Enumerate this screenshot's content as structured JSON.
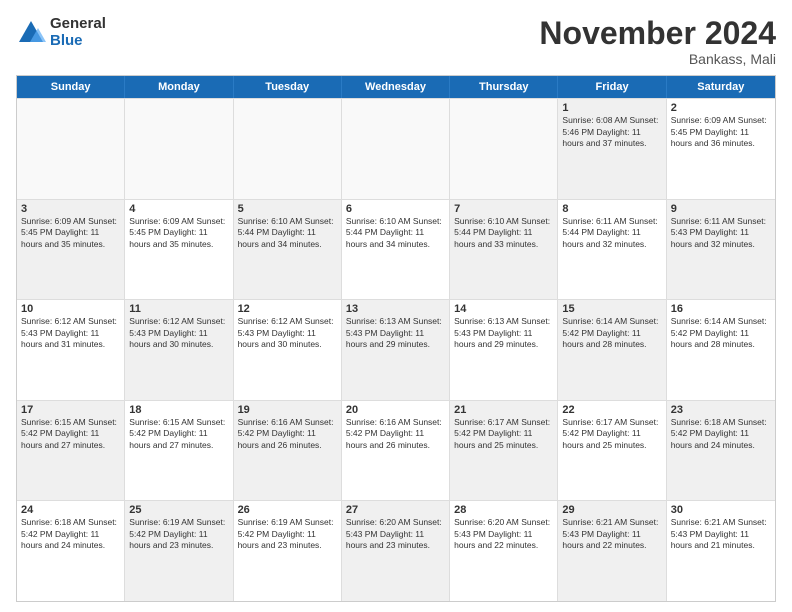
{
  "header": {
    "logo_general": "General",
    "logo_blue": "Blue",
    "month_title": "November 2024",
    "location": "Bankass, Mali"
  },
  "calendar": {
    "days_of_week": [
      "Sunday",
      "Monday",
      "Tuesday",
      "Wednesday",
      "Thursday",
      "Friday",
      "Saturday"
    ],
    "rows": [
      [
        {
          "day": "",
          "info": "",
          "empty": true
        },
        {
          "day": "",
          "info": "",
          "empty": true
        },
        {
          "day": "",
          "info": "",
          "empty": true
        },
        {
          "day": "",
          "info": "",
          "empty": true
        },
        {
          "day": "",
          "info": "",
          "empty": true
        },
        {
          "day": "1",
          "info": "Sunrise: 6:08 AM\nSunset: 5:46 PM\nDaylight: 11 hours\nand 37 minutes.",
          "shaded": true
        },
        {
          "day": "2",
          "info": "Sunrise: 6:09 AM\nSunset: 5:45 PM\nDaylight: 11 hours\nand 36 minutes.",
          "shaded": false
        }
      ],
      [
        {
          "day": "3",
          "info": "Sunrise: 6:09 AM\nSunset: 5:45 PM\nDaylight: 11 hours\nand 35 minutes.",
          "shaded": true
        },
        {
          "day": "4",
          "info": "Sunrise: 6:09 AM\nSunset: 5:45 PM\nDaylight: 11 hours\nand 35 minutes.",
          "shaded": false
        },
        {
          "day": "5",
          "info": "Sunrise: 6:10 AM\nSunset: 5:44 PM\nDaylight: 11 hours\nand 34 minutes.",
          "shaded": true
        },
        {
          "day": "6",
          "info": "Sunrise: 6:10 AM\nSunset: 5:44 PM\nDaylight: 11 hours\nand 34 minutes.",
          "shaded": false
        },
        {
          "day": "7",
          "info": "Sunrise: 6:10 AM\nSunset: 5:44 PM\nDaylight: 11 hours\nand 33 minutes.",
          "shaded": true
        },
        {
          "day": "8",
          "info": "Sunrise: 6:11 AM\nSunset: 5:44 PM\nDaylight: 11 hours\nand 32 minutes.",
          "shaded": false
        },
        {
          "day": "9",
          "info": "Sunrise: 6:11 AM\nSunset: 5:43 PM\nDaylight: 11 hours\nand 32 minutes.",
          "shaded": true
        }
      ],
      [
        {
          "day": "10",
          "info": "Sunrise: 6:12 AM\nSunset: 5:43 PM\nDaylight: 11 hours\nand 31 minutes.",
          "shaded": false
        },
        {
          "day": "11",
          "info": "Sunrise: 6:12 AM\nSunset: 5:43 PM\nDaylight: 11 hours\nand 30 minutes.",
          "shaded": true
        },
        {
          "day": "12",
          "info": "Sunrise: 6:12 AM\nSunset: 5:43 PM\nDaylight: 11 hours\nand 30 minutes.",
          "shaded": false
        },
        {
          "day": "13",
          "info": "Sunrise: 6:13 AM\nSunset: 5:43 PM\nDaylight: 11 hours\nand 29 minutes.",
          "shaded": true
        },
        {
          "day": "14",
          "info": "Sunrise: 6:13 AM\nSunset: 5:43 PM\nDaylight: 11 hours\nand 29 minutes.",
          "shaded": false
        },
        {
          "day": "15",
          "info": "Sunrise: 6:14 AM\nSunset: 5:42 PM\nDaylight: 11 hours\nand 28 minutes.",
          "shaded": true
        },
        {
          "day": "16",
          "info": "Sunrise: 6:14 AM\nSunset: 5:42 PM\nDaylight: 11 hours\nand 28 minutes.",
          "shaded": false
        }
      ],
      [
        {
          "day": "17",
          "info": "Sunrise: 6:15 AM\nSunset: 5:42 PM\nDaylight: 11 hours\nand 27 minutes.",
          "shaded": true
        },
        {
          "day": "18",
          "info": "Sunrise: 6:15 AM\nSunset: 5:42 PM\nDaylight: 11 hours\nand 27 minutes.",
          "shaded": false
        },
        {
          "day": "19",
          "info": "Sunrise: 6:16 AM\nSunset: 5:42 PM\nDaylight: 11 hours\nand 26 minutes.",
          "shaded": true
        },
        {
          "day": "20",
          "info": "Sunrise: 6:16 AM\nSunset: 5:42 PM\nDaylight: 11 hours\nand 26 minutes.",
          "shaded": false
        },
        {
          "day": "21",
          "info": "Sunrise: 6:17 AM\nSunset: 5:42 PM\nDaylight: 11 hours\nand 25 minutes.",
          "shaded": true
        },
        {
          "day": "22",
          "info": "Sunrise: 6:17 AM\nSunset: 5:42 PM\nDaylight: 11 hours\nand 25 minutes.",
          "shaded": false
        },
        {
          "day": "23",
          "info": "Sunrise: 6:18 AM\nSunset: 5:42 PM\nDaylight: 11 hours\nand 24 minutes.",
          "shaded": true
        }
      ],
      [
        {
          "day": "24",
          "info": "Sunrise: 6:18 AM\nSunset: 5:42 PM\nDaylight: 11 hours\nand 24 minutes.",
          "shaded": false
        },
        {
          "day": "25",
          "info": "Sunrise: 6:19 AM\nSunset: 5:42 PM\nDaylight: 11 hours\nand 23 minutes.",
          "shaded": true
        },
        {
          "day": "26",
          "info": "Sunrise: 6:19 AM\nSunset: 5:42 PM\nDaylight: 11 hours\nand 23 minutes.",
          "shaded": false
        },
        {
          "day": "27",
          "info": "Sunrise: 6:20 AM\nSunset: 5:43 PM\nDaylight: 11 hours\nand 23 minutes.",
          "shaded": true
        },
        {
          "day": "28",
          "info": "Sunrise: 6:20 AM\nSunset: 5:43 PM\nDaylight: 11 hours\nand 22 minutes.",
          "shaded": false
        },
        {
          "day": "29",
          "info": "Sunrise: 6:21 AM\nSunset: 5:43 PM\nDaylight: 11 hours\nand 22 minutes.",
          "shaded": true
        },
        {
          "day": "30",
          "info": "Sunrise: 6:21 AM\nSunset: 5:43 PM\nDaylight: 11 hours\nand 21 minutes.",
          "shaded": false
        }
      ]
    ]
  }
}
